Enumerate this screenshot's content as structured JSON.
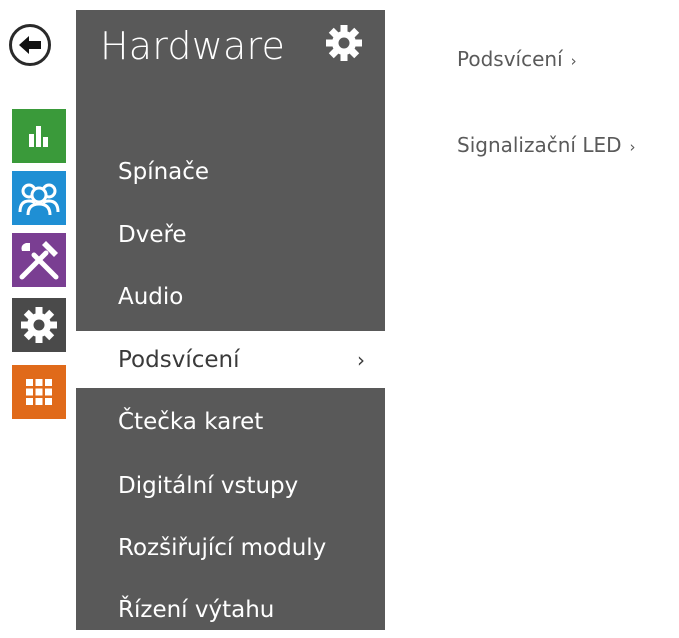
{
  "nav": {
    "back_icon": "arrow-left-icon",
    "rail": [
      {
        "icon": "bar-chart-icon",
        "color": "#3a9a3a"
      },
      {
        "icon": "users-icon",
        "color": "#1f8fd4"
      },
      {
        "icon": "tools-icon",
        "color": "#7a3e92"
      },
      {
        "icon": "gear-icon",
        "color": "#4a4a4a"
      },
      {
        "icon": "grid-icon",
        "color": "#e06a1a"
      }
    ]
  },
  "submenu": {
    "title": "Hardware",
    "title_icon": "gear-icon",
    "background": "#595959",
    "items": [
      {
        "label": "Spínače",
        "active": false
      },
      {
        "label": "Dveře",
        "active": false
      },
      {
        "label": "Audio",
        "active": false
      },
      {
        "label": "Podsvícení",
        "active": true
      },
      {
        "label": "Čtečka karet",
        "active": false
      },
      {
        "label": "Digitální vstupy",
        "active": false
      },
      {
        "label": "Rozšiřující moduly",
        "active": false
      },
      {
        "label": "Řízení výtahu",
        "active": false
      }
    ],
    "active_chevron": "›"
  },
  "content": {
    "links": [
      {
        "label": "Podsvícení",
        "arrow": "›"
      },
      {
        "label": "Signalizační LED",
        "arrow": "›"
      }
    ]
  }
}
